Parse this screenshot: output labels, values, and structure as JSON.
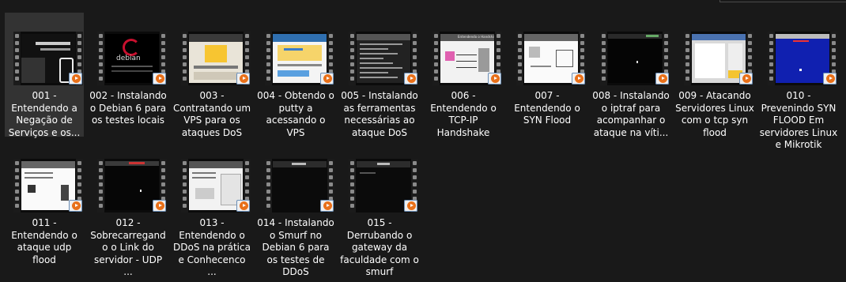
{
  "items": [
    {
      "label": "001 - Entendendo a Negação de Serviços e os...",
      "thumb": "wifi-zone-icon",
      "selected": true
    },
    {
      "label": "002 - Instalando o Debian 6 para os testes locais",
      "thumb": "debian-logo-icon",
      "thumb_text": "debian"
    },
    {
      "label": "003 - Contratando um VPS para os ataques DoS",
      "thumb": "web-page"
    },
    {
      "label": "004 - Obtendo o putty a acessando o VPS",
      "thumb": "web-page-blue"
    },
    {
      "label": "005 - Instalando as ferramentas necessárias ao ataque DoS",
      "thumb": "terminal"
    },
    {
      "label": "006 - Entendendo o TCP-IP Handshake",
      "thumb": "handshake-slide",
      "thumb_text": "Entendendo o Handshake"
    },
    {
      "label": "007 - Entendendo o SYN Flood",
      "thumb": "syn-slide"
    },
    {
      "label": "008 - Instalando o iptraf para acompanhar o ataque na víti...",
      "thumb": "black-terminal"
    },
    {
      "label": "009 - Atacando Servidores Linux com o tcp syn flood",
      "thumb": "window-screenshot"
    },
    {
      "label": "010 - Prevenindo SYN FLOOD Em servidores Linux e Mikrotik",
      "thumb": "blue-screen"
    },
    {
      "label": "011 - Entendendo o ataque udp flood",
      "thumb": "udp-slide"
    },
    {
      "label": "012 - Sobrecarregando o Link do servidor - UDP ...",
      "thumb": "black-terminal-2"
    },
    {
      "label": "013 - Entendendo o DDoS na prática e Conhecenco ...",
      "thumb": "ddos-slide"
    },
    {
      "label": "014 - Instalando o Smurf no Debian 6 para os testes de DDoS",
      "thumb": "dark-window"
    },
    {
      "label": "015 - Derrubando o gateway da faculdade com o smurf",
      "thumb": "dark-window-2"
    }
  ],
  "colors": {
    "background": "#191919",
    "selected": "#333333",
    "play_accent": "#e8701a"
  }
}
